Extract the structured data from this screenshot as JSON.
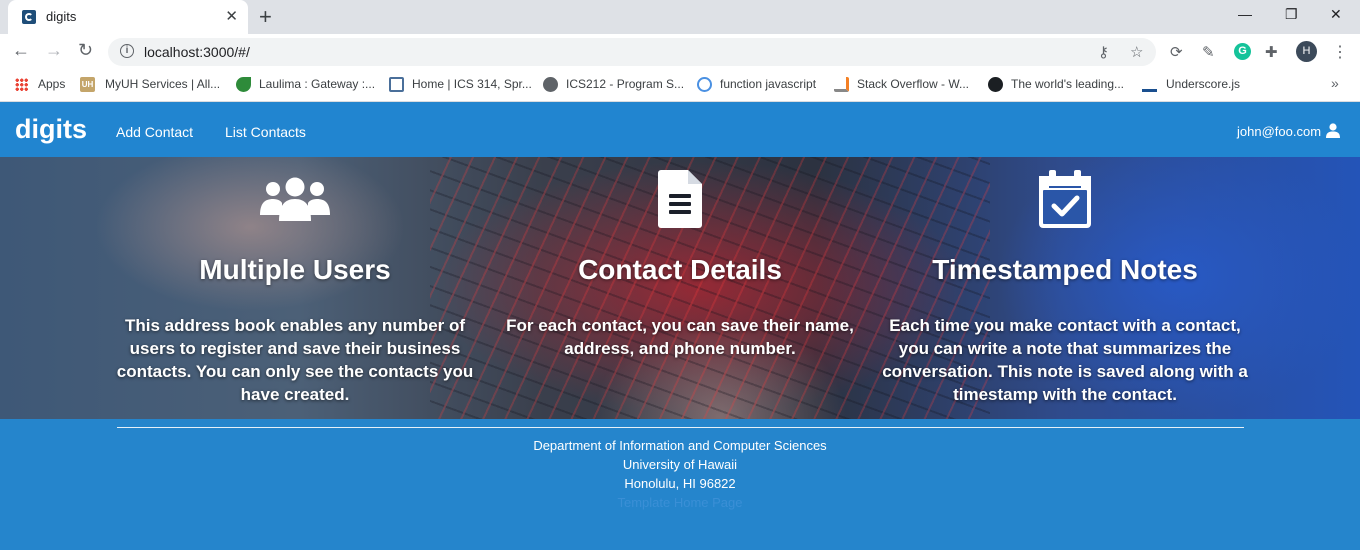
{
  "browser": {
    "tab_title": "digits",
    "tab_close": "✕",
    "new_tab": "+",
    "url": "localhost:3000/#/",
    "profile_initial": "H",
    "window_controls": {
      "minimize": "—",
      "restore": "❐",
      "close": "✕"
    },
    "bookmarks": [
      {
        "label": "Apps",
        "icon": "apps-grid-icon"
      },
      {
        "label": "MyUH Services | All...",
        "icon": "uh-icon"
      },
      {
        "label": "Laulima : Gateway :...",
        "icon": "laulima-icon"
      },
      {
        "label": "Home | ICS 314, Spr...",
        "icon": "page-icon"
      },
      {
        "label": "ICS212 - Program S...",
        "icon": "globe-icon"
      },
      {
        "label": "function javascript",
        "icon": "cloud-icon"
      },
      {
        "label": "Stack Overflow - W...",
        "icon": "stackoverflow-icon"
      },
      {
        "label": "The world's leading...",
        "icon": "github-icon"
      },
      {
        "label": "Underscore.js",
        "icon": "underscore-icon"
      }
    ],
    "bookmarks_more": "»"
  },
  "navbar": {
    "brand": "digits",
    "links": [
      "Add Contact",
      "List Contacts"
    ],
    "user": "john@foo.com",
    "color": "#2185d0"
  },
  "features": [
    {
      "icon": "users-icon",
      "title": "Multiple Users",
      "desc": "This address book enables any number of users to register and save their business contacts. You can only see the contacts you have created."
    },
    {
      "icon": "file-text-icon",
      "title": "Contact Details",
      "desc": "For each contact, you can save their name, address, and phone number."
    },
    {
      "icon": "calendar-check-icon",
      "title": "Timestamped Notes",
      "desc": "Each time you make contact with a contact, you can write a note that summarizes the conversation. This note is saved along with a timestamp with the contact."
    }
  ],
  "footer": {
    "lines": [
      "Department of Information and Computer Sciences",
      "University of Hawaii",
      "Honolulu, HI 96822"
    ],
    "link": "Template Home Page",
    "background": "#2585cc"
  }
}
